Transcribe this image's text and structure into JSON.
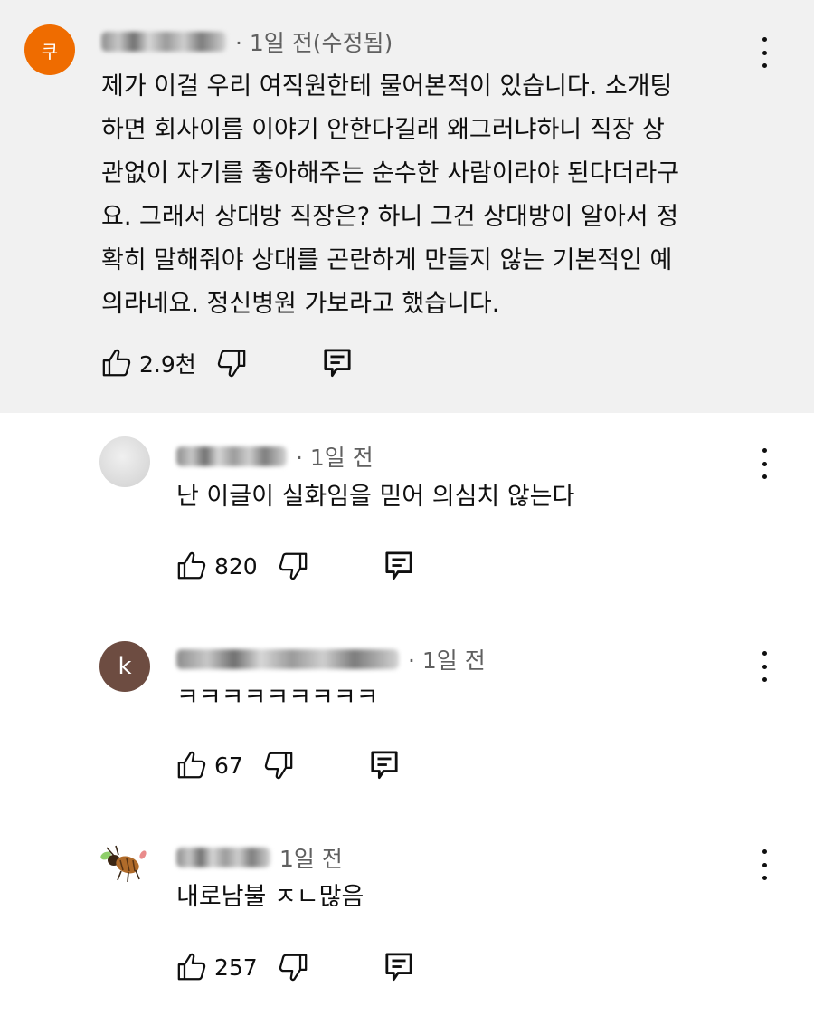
{
  "comments": {
    "top": {
      "avatar_letter": "쿠",
      "avatar_color": "#ef6c00",
      "meta": "· 1일 전(수정됨)",
      "lines": [
        "제가 이걸 우리 여직원한테 물어본적이 있습니다.  소개팅",
        "하면 회사이름 이야기 안한다길래  왜그러냐하니 직장 상",
        "관없이 자기를 좋아해주는 순수한 사람이라야 된다더라구",
        "요. 그래서 상대방 직장은? 하니 그건 상대방이 알아서 정",
        "확히 말해줘야 상대를 곤란하게 만들지 않는 기본적인 예",
        "의라네요. 정신병원 가보라고 했습니다."
      ],
      "likes": "2.9천"
    },
    "replies": [
      {
        "meta": "· 1일 전",
        "text": "난 이글이 실화임을 믿어 의심치 않는다",
        "likes": "820"
      },
      {
        "avatar_letter": "k",
        "avatar_color": "#6d4c41",
        "meta": "· 1일 전",
        "text": "ㅋㅋㅋㅋㅋㅋㅋㅋㅋ",
        "likes": "67"
      },
      {
        "meta": "1일 전",
        "text": "내로남불 ㅈㄴ많음",
        "likes": "257"
      }
    ]
  },
  "icons": {
    "like": "thumbs-up-icon",
    "dislike": "thumbs-down-icon",
    "reply": "reply-icon",
    "menu": "more-vertical-icon"
  }
}
